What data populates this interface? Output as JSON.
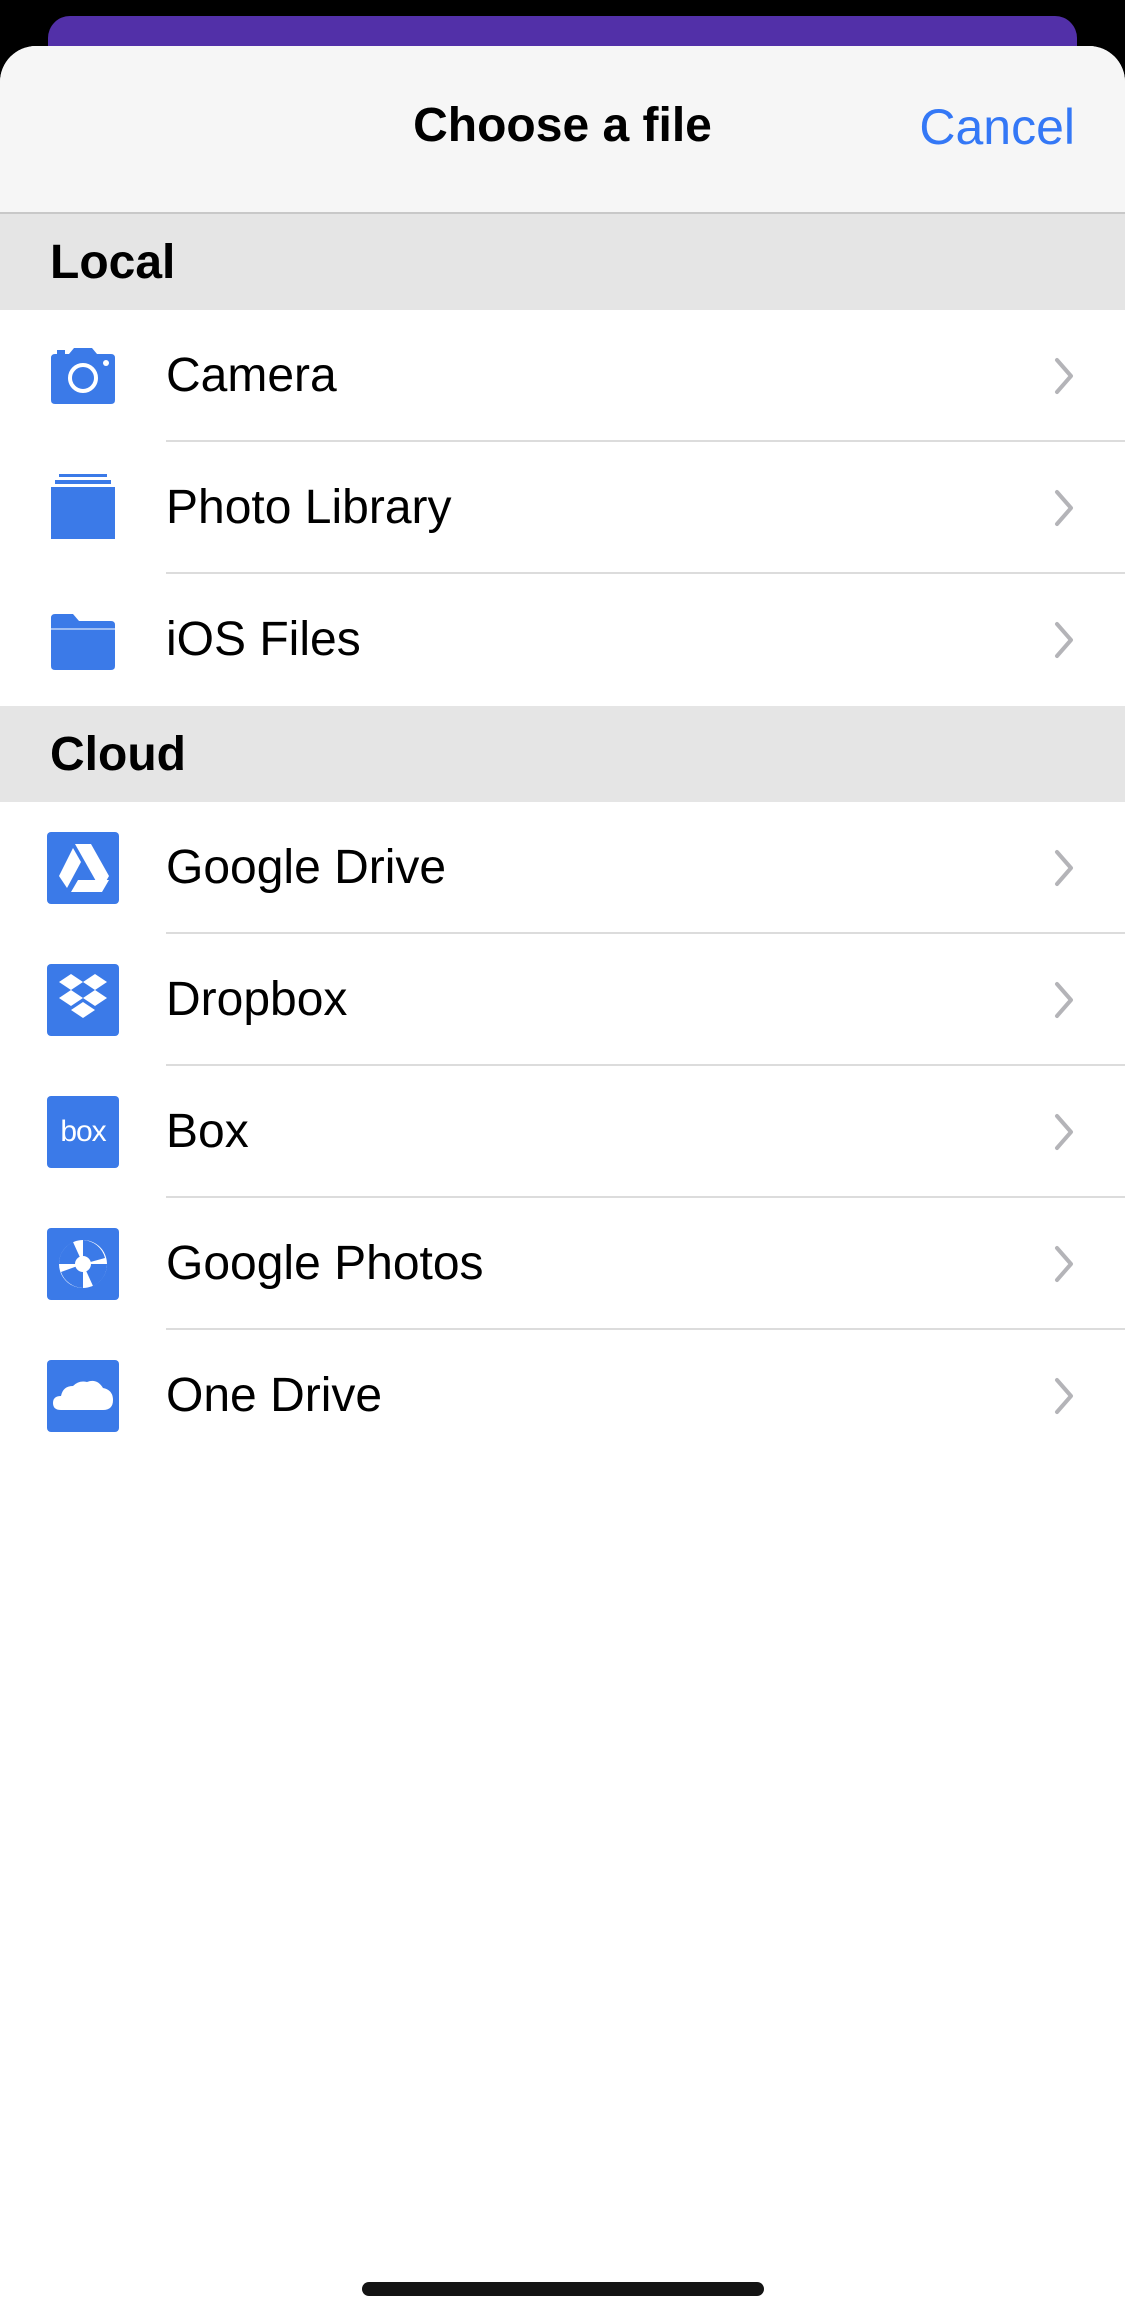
{
  "sheet": {
    "title": "Choose a file",
    "cancel_label": "Cancel"
  },
  "sections": [
    {
      "title": "Local",
      "items": [
        {
          "label": "Camera",
          "icon": "camera-icon"
        },
        {
          "label": "Photo Library",
          "icon": "photo-library-icon"
        },
        {
          "label": "iOS Files",
          "icon": "folder-icon"
        }
      ]
    },
    {
      "title": "Cloud",
      "items": [
        {
          "label": "Google Drive",
          "icon": "google-drive-icon"
        },
        {
          "label": "Dropbox",
          "icon": "dropbox-icon"
        },
        {
          "label": "Box",
          "icon": "box-icon",
          "icon_text": "box"
        },
        {
          "label": "Google Photos",
          "icon": "google-photos-icon"
        },
        {
          "label": "One Drive",
          "icon": "onedrive-icon"
        }
      ]
    }
  ],
  "colors": {
    "accent": "#3478f6",
    "icon_blue": "#3b7ae8",
    "peek_card": "#5230a8",
    "section_bg": "#e5e5e5",
    "nav_bg": "#f6f6f6"
  }
}
